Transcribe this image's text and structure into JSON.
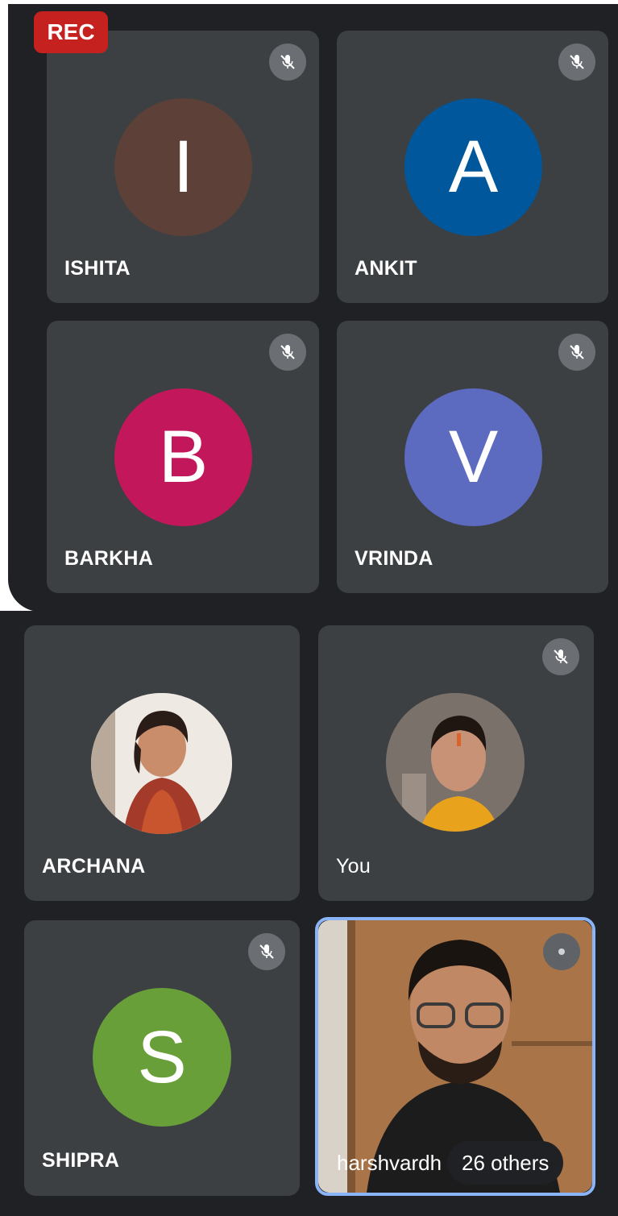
{
  "recording": {
    "label": "REC",
    "color": "#c5221f"
  },
  "participants": [
    {
      "name": "ISHITA",
      "initial": "I",
      "avatar_color": "#5d4037",
      "muted": true
    },
    {
      "name": "ANKIT",
      "initial": "A",
      "avatar_color": "#01579b",
      "muted": true
    },
    {
      "name": "BARKHA",
      "initial": "B",
      "avatar_color": "#c2185b",
      "muted": true
    },
    {
      "name": "VRINDA",
      "initial": "V",
      "avatar_color": "#5c6bc0",
      "muted": true
    },
    {
      "name": "ARCHANA",
      "avatar_type": "photo",
      "muted": false
    },
    {
      "name": "You",
      "avatar_type": "photo",
      "muted": true
    },
    {
      "name": "SHIPRA",
      "initial": "S",
      "avatar_color": "#689f38",
      "muted": true
    }
  ],
  "active_speaker": {
    "name": "harshvardh",
    "others_label": "26 others",
    "highlight_color": "#8ab4f8"
  },
  "icons": {
    "mute": "mic-off-icon",
    "speaking": "audio-indicator-icon"
  }
}
